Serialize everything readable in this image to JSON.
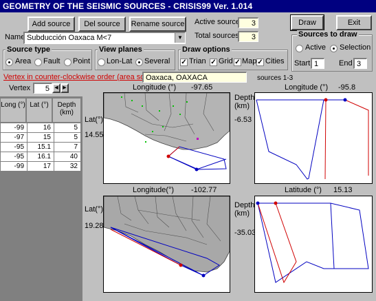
{
  "window": {
    "title": "GEOMETRY OF THE SEISMIC SOURCES - CRISIS99   Ver. 1.014"
  },
  "toolbar": {
    "add_source": "Add source",
    "del_source": "Del source",
    "rename_source": "Rename source",
    "draw": "Draw",
    "exit": "Exit"
  },
  "source": {
    "name_label": "Name",
    "name_value": "Subducción Oaxaca M<7",
    "active_label": "Active source",
    "active_value": "3",
    "total_label": "Total sources",
    "total_value": "3"
  },
  "source_type": {
    "title": "Source type",
    "options": [
      "Area",
      "Fault",
      "Point"
    ],
    "selected": "Area"
  },
  "view_planes": {
    "title": "View planes",
    "options": [
      "Lon-Lat",
      "Several"
    ],
    "selected": "Several"
  },
  "draw_options": {
    "title": "Draw options",
    "options": [
      "Trian",
      "Grid",
      "Map",
      "Cities"
    ],
    "checked": [
      true,
      true,
      true,
      true
    ]
  },
  "sources_to_draw": {
    "title": "Sources to draw",
    "options": [
      "Active",
      "Selection"
    ],
    "selected": "Selection",
    "start_label": "Start",
    "start_value": "1",
    "end_label": "End",
    "end_value": "3"
  },
  "vertex": {
    "warning": "Vertex in counter-clockwise order (area source)",
    "city": "Oaxaca, OAXACA",
    "sources_range": "sources 1-3",
    "label": "Vertex",
    "value": "5",
    "columns": [
      "Long (°)",
      "Lat (°)",
      "Depth (km)"
    ],
    "rows": [
      [
        "-99",
        "16",
        "5"
      ],
      [
        "-97",
        "15",
        "5"
      ],
      [
        "-95",
        "15.1",
        "7"
      ],
      [
        "-95",
        "16.1",
        "40"
      ],
      [
        "-99",
        "17",
        "32"
      ]
    ]
  },
  "views": {
    "top_left": {
      "axis_title": "Longitude (°)",
      "axis_value": "-97.65",
      "side_label": "Lat(°)",
      "side_value": "14.55"
    },
    "top_right": {
      "axis_title": "Longitude (°)",
      "axis_value": "-95.8",
      "side_label": "Depth (km)",
      "side_value": "-6.53"
    },
    "bottom_left": {
      "axis_title": "Longitude(°)",
      "axis_value": "-102.77",
      "side_label": "Lat(°)",
      "side_value": "19.28"
    },
    "bottom_right": {
      "axis_title": "Latitude (°)",
      "axis_value": "15.13",
      "side_label": "Depth (km)",
      "side_value": "-35.03"
    }
  },
  "colors": {
    "title_bar": "#000080",
    "polygon": "#0000c0",
    "polygon_alt": "#d00000",
    "map_fill": "#a8a8a8"
  }
}
